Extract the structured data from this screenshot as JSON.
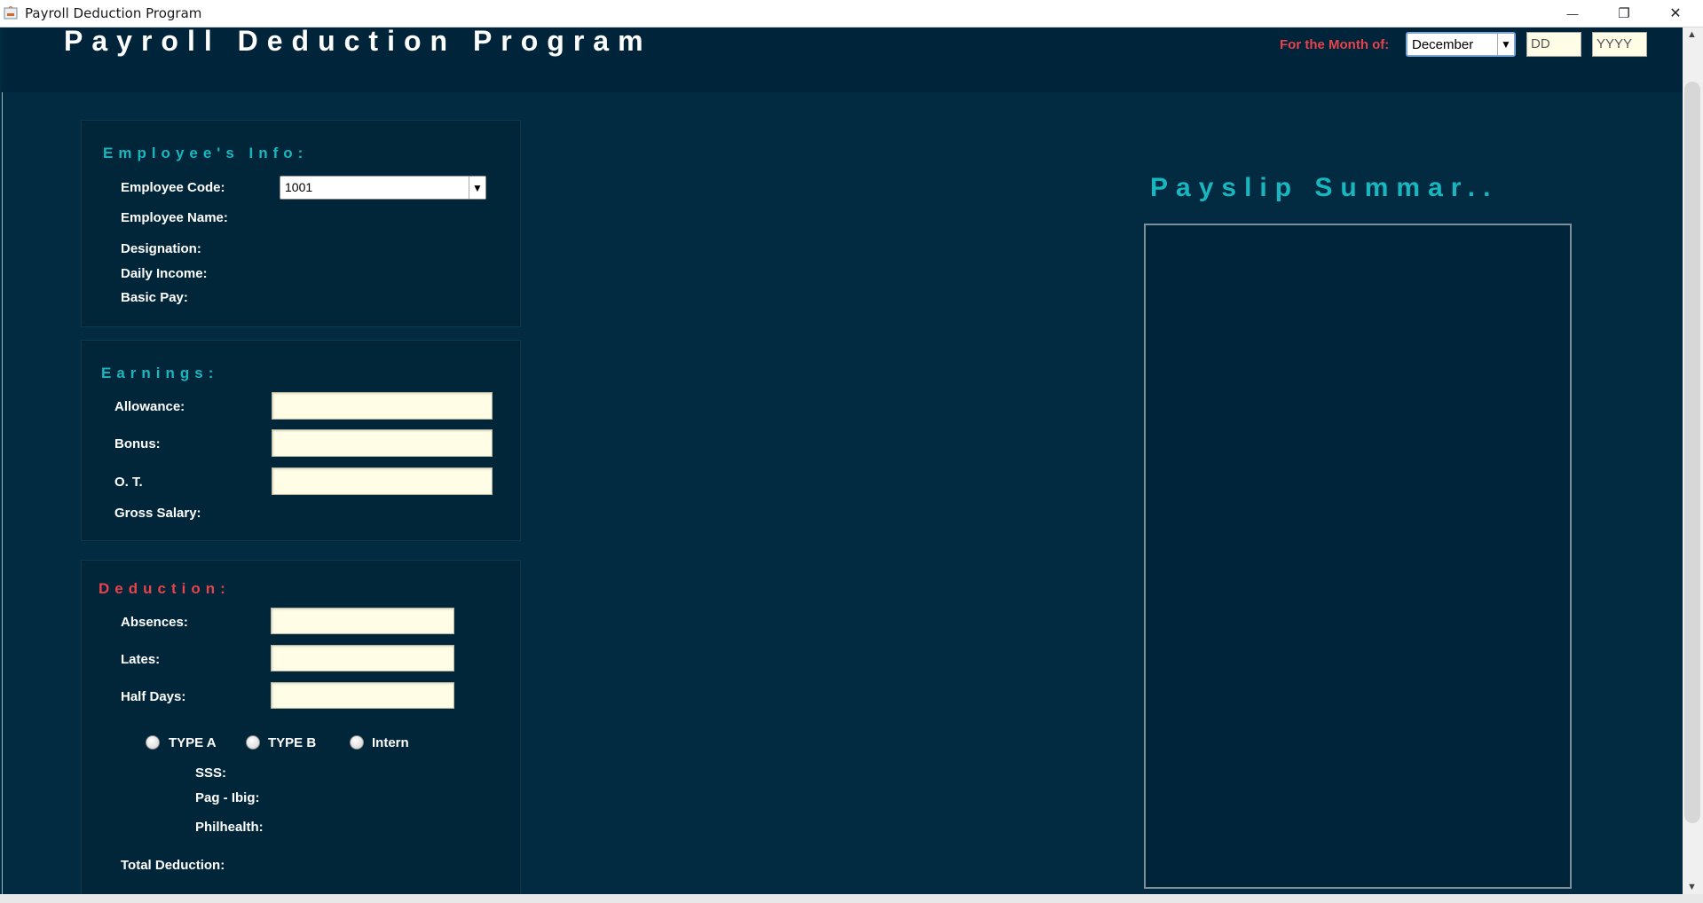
{
  "window": {
    "title": "Payroll Deduction Program",
    "minimize_glyph": "—",
    "restore_glyph": "❐",
    "close_glyph": "✕"
  },
  "header": {
    "program_title": "Payroll Deduction Program",
    "month_label": "For the Month of:",
    "month_value": "December",
    "day_placeholder": "DD",
    "year_placeholder": "YYYY"
  },
  "employee_info": {
    "title": "Employee's Info:",
    "code_label": "Employee Code:",
    "code_value": "1001",
    "name_label": "Employee Name:",
    "designation_label": "Designation:",
    "daily_income_label": "Daily Income:",
    "basic_pay_label": "Basic Pay:"
  },
  "earnings": {
    "title": "Earnings:",
    "allowance_label": "Allowance:",
    "bonus_label": "Bonus:",
    "ot_label": "O. T.",
    "gross_label": "Gross Salary:"
  },
  "deduction": {
    "title": "Deduction:",
    "absences_label": "Absences:",
    "lates_label": "Lates:",
    "halfdays_label": "Half Days:",
    "types": [
      "TYPE A",
      "TYPE B",
      "Intern"
    ],
    "sss_label": "SSS:",
    "pagibig_label": "Pag - Ibig:",
    "philhealth_label": "Philhealth:",
    "total_label": "Total Deduction:"
  },
  "payslip": {
    "title": "Payslip Summar.."
  },
  "colors": {
    "background": "#002a40",
    "accent_cyan": "#18b7c0",
    "accent_red": "#e8424a",
    "field_bg": "#fffde6"
  },
  "icons": {
    "app": "java-app-icon",
    "dropdown": "chevron-down-icon"
  }
}
